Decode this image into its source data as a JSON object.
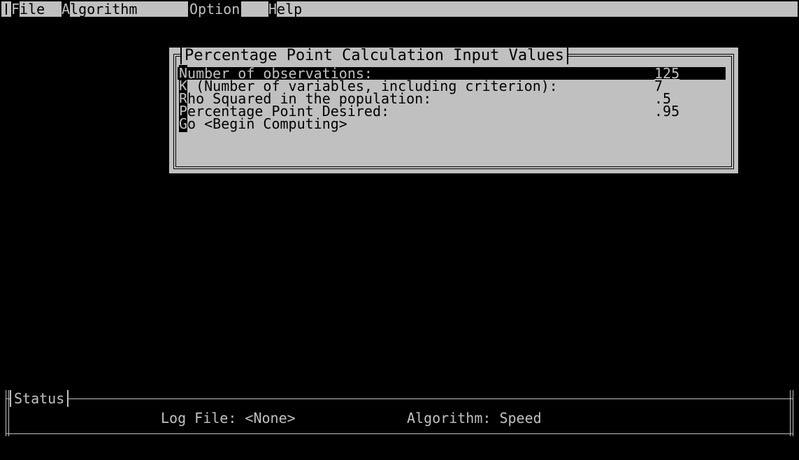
{
  "menu": {
    "items": [
      {
        "hotkey": "F",
        "rest": "ile"
      },
      {
        "hotkey": "A",
        "rest": "lgorithm"
      },
      {
        "hotkey": "O",
        "rest": "ption"
      },
      {
        "hotkey": "H",
        "rest": "elp"
      }
    ],
    "active_index": 2
  },
  "dialog": {
    "title": "Percentage Point Calculation Input Values",
    "rows": [
      {
        "hotkey": "N",
        "rest": "umber of observations:",
        "value": "125"
      },
      {
        "hotkey": "K",
        "rest": " (Number of variables, including criterion):",
        "value": "7"
      },
      {
        "hotkey": "R",
        "rest": "ho Squared in the population:",
        "value": ".5"
      },
      {
        "hotkey": "P",
        "rest": "ercentage Point Desired:",
        "value": ".95"
      },
      {
        "hotkey": "G",
        "rest": "o <Begin Computing>",
        "value": ""
      }
    ]
  },
  "status": {
    "title": "Status",
    "log_file": "Log File: <None>",
    "algorithm": "Algorithm: Speed"
  },
  "colors": {
    "background": "#000000",
    "panel": "#c0c0c0",
    "text_dark": "#000000",
    "text_light": "#c0c0c0"
  }
}
